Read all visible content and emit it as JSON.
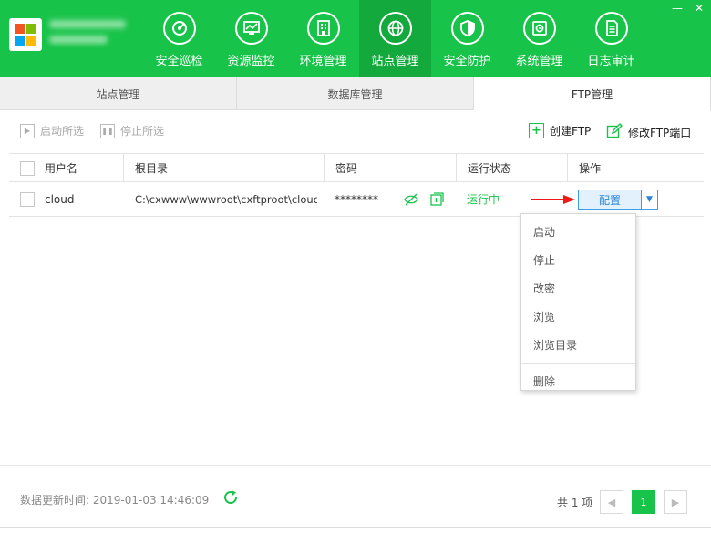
{
  "colors": {
    "header": "#18c34a",
    "header_active": "#13a93d",
    "accent_blue": "#2a85d6",
    "running_green": "#18c34a"
  },
  "window": {
    "minimize_glyph": "—",
    "close_glyph": "✕"
  },
  "nav": [
    {
      "label": "安全巡检",
      "icon": "security-scan-icon"
    },
    {
      "label": "资源监控",
      "icon": "monitor-chart-icon"
    },
    {
      "label": "环境管理",
      "icon": "building-icon"
    },
    {
      "label": "站点管理",
      "icon": "globe-icon",
      "active": true
    },
    {
      "label": "安全防护",
      "icon": "shield-icon"
    },
    {
      "label": "系统管理",
      "icon": "gear-icon"
    },
    {
      "label": "日志审计",
      "icon": "document-icon"
    }
  ],
  "tabs": [
    {
      "label": "站点管理"
    },
    {
      "label": "数据库管理"
    },
    {
      "label": "FTP管理",
      "active": true
    }
  ],
  "toolbar": {
    "start_selected": "启动所选",
    "stop_selected": "停止所选",
    "create_ftp": "创建FTP",
    "modify_port": "修改FTP端口"
  },
  "table": {
    "headers": [
      "用户名",
      "根目录",
      "密码",
      "运行状态",
      "操作"
    ],
    "rows": [
      {
        "username": "cloud",
        "root": "C:\\cxwww\\wwwroot\\cxftproot\\cloud",
        "password": "********",
        "status": "运行中",
        "action": "配置"
      }
    ]
  },
  "menu": {
    "items": [
      "启动",
      "停止",
      "改密",
      "浏览",
      "浏览目录"
    ],
    "danger": "删除"
  },
  "footer": {
    "update_time": "数据更新时间: 2019-01-03 14:46:09",
    "total": "共 1 项",
    "prev": "◀",
    "current_page": "1",
    "next": "▶"
  }
}
